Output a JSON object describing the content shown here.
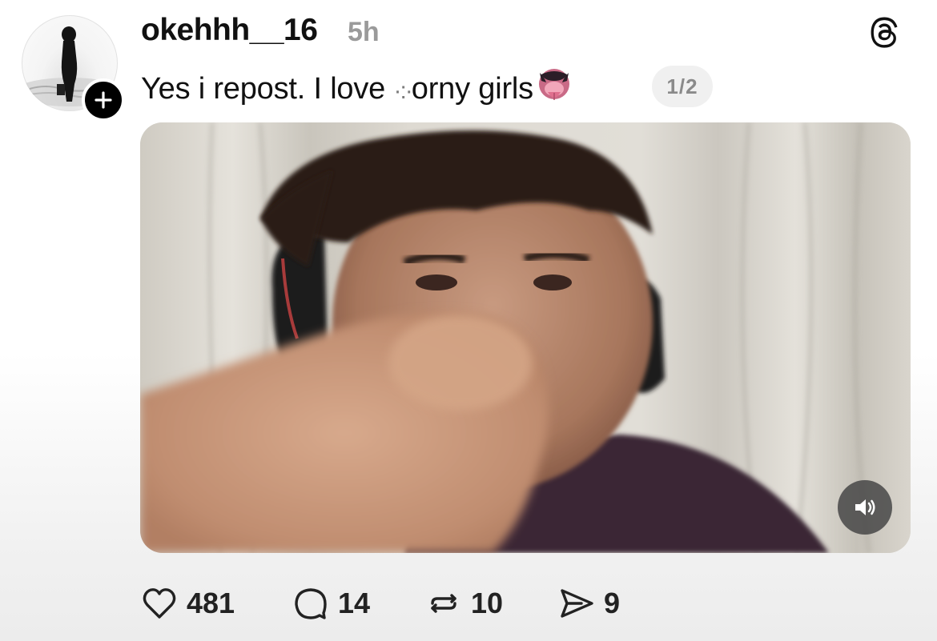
{
  "post": {
    "username": "okehhh__16",
    "timestamp": "5h",
    "caption_before": "Yes i repost. I love ",
    "caption_masked": "·:·",
    "caption_after": "orny girls",
    "caption_emoji": "tongue-out-face-emoji",
    "page_counter": "1/2"
  },
  "icons": {
    "follow": "plus-icon",
    "app_logo": "threads-logo-icon",
    "volume": "speaker-icon",
    "like": "heart-icon",
    "comment": "comment-bubble-icon",
    "repost": "repost-icon",
    "share": "send-icon"
  },
  "actions": {
    "likes": "481",
    "comments": "14",
    "reposts": "10",
    "shares": "9"
  },
  "colors": {
    "text": "#111111",
    "muted": "#9a9a9a",
    "counter_bg": "#f0f0f0"
  }
}
